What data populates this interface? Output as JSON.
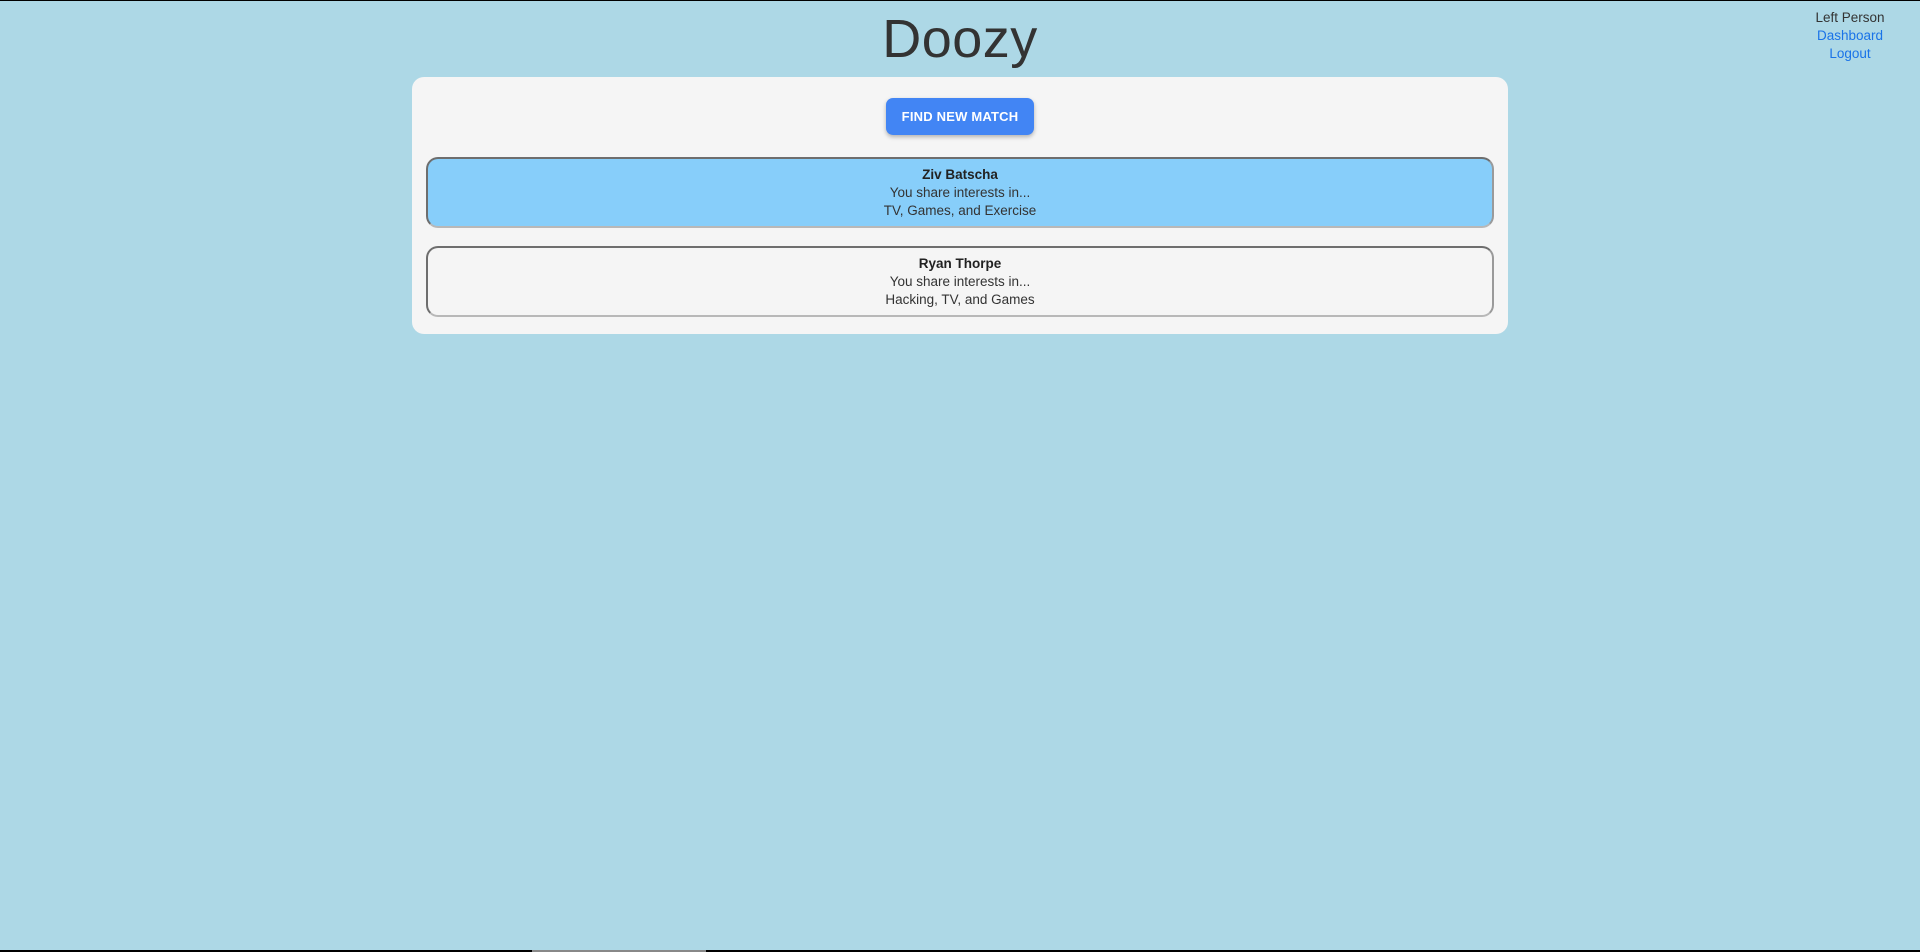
{
  "header": {
    "title": "Doozy"
  },
  "user_menu": {
    "name": "Left Person",
    "dashboard_label": "Dashboard",
    "logout_label": "Logout"
  },
  "main": {
    "find_button_label": "FIND NEW MATCH",
    "matches": [
      {
        "name": "Ziv Batscha",
        "intro": "You share interests in...",
        "interests": "TV, Games, and Exercise",
        "selected": true
      },
      {
        "name": "Ryan Thorpe",
        "intro": "You share interests in...",
        "interests": "Hacking, TV, and Games",
        "selected": false
      }
    ]
  },
  "colors": {
    "page_background": "#add8e6",
    "panel_background": "#f5f5f5",
    "button_primary": "#4285f4",
    "selected_card": "#87cefa",
    "link": "#1a73e8"
  }
}
